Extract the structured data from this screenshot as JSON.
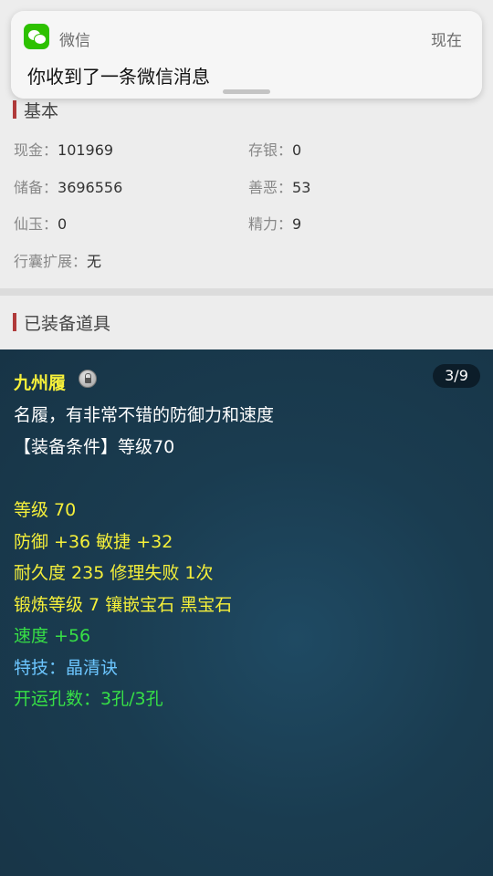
{
  "notification": {
    "app_name": "微信",
    "time": "现在",
    "message": "你收到了一条微信消息"
  },
  "basic_section": {
    "title": "基本",
    "stats": [
      {
        "label": "现金：",
        "value": "101969"
      },
      {
        "label": "存银：",
        "value": "0"
      },
      {
        "label": "储备：",
        "value": "3696556"
      },
      {
        "label": "善恶：",
        "value": "53"
      },
      {
        "label": "仙玉：",
        "value": "0"
      },
      {
        "label": "精力：",
        "value": "9"
      },
      {
        "label": "行囊扩展：",
        "value": "无"
      }
    ]
  },
  "equipped_section": {
    "title": "已装备道具"
  },
  "item_tooltip": {
    "name": "九州履",
    "page_counter": "3/9",
    "description": "名履，有非常不错的防御力和速度",
    "requirement": "【装备条件】等级70",
    "level": "等级 70",
    "defense_agility": "防御 +36 敏捷 +32",
    "durability": "耐久度 235 修理失败 1次",
    "forge": "锻炼等级 7 镶嵌宝石 黑宝石",
    "speed": "速度 +56",
    "skill": "特技：晶清诀",
    "sockets": "开运孔数：3孔/3孔",
    "colors": {
      "yellow": "#f6f03a",
      "green": "#37e046",
      "blue": "#6cc6ff",
      "white": "#ffffff"
    }
  }
}
